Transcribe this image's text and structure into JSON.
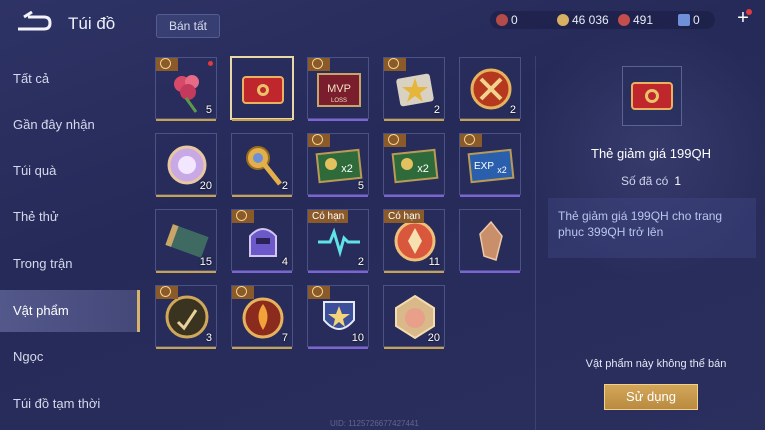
{
  "header": {
    "title": "Túi đồ",
    "sell_all_label": "Bán tất",
    "currencies": [
      {
        "icon": "red-gem-icon",
        "value": "0",
        "color": "#b44a4a"
      },
      {
        "icon": "gold-coin-icon",
        "value": "46 036",
        "color": "#d8b063"
      },
      {
        "icon": "red-crystal-icon",
        "value": "491",
        "color": "#c44d4d"
      },
      {
        "icon": "blue-voucher-icon",
        "value": "0",
        "color": "#6f8fd8"
      }
    ]
  },
  "sidebar": {
    "items": [
      {
        "label": "Tất cả"
      },
      {
        "label": "Gần đây nhận"
      },
      {
        "label": "Túi quà"
      },
      {
        "label": "Thẻ thử"
      },
      {
        "label": "Trong trận"
      },
      {
        "label": "Vật phẩm",
        "active": true
      },
      {
        "label": "Ngọc"
      },
      {
        "label": "Túi đồ tạm thời"
      }
    ]
  },
  "items": [
    {
      "icon": "rose-bouquet-icon",
      "count": "5",
      "tag": "coin",
      "red_dot": true,
      "under": "#c9a24a"
    },
    {
      "icon": "discount-card-icon",
      "count": "",
      "tag": "",
      "selected": true,
      "under": "#c9a24a"
    },
    {
      "icon": "mvp-loss-card-icon",
      "count": "",
      "tag": "coin",
      "under": "#7f62d8"
    },
    {
      "icon": "star-ticket-icon",
      "count": "2",
      "tag": "coin",
      "under": "#c9a24a"
    },
    {
      "icon": "crossed-swords-medal-icon",
      "count": "2",
      "tag": "",
      "under": "#c9a24a"
    },
    {
      "icon": "pink-orb-icon",
      "count": "20",
      "tag": "",
      "under": "#c9a24a"
    },
    {
      "icon": "golden-key-icon",
      "count": "2",
      "tag": "",
      "under": "#c9a24a"
    },
    {
      "icon": "coin-x2-card-icon",
      "count": "5",
      "tag": "coin",
      "under": "#7f62d8"
    },
    {
      "icon": "coin-x2-card-icon",
      "count": "",
      "tag": "coin",
      "under": "#7f62d8"
    },
    {
      "icon": "exp-x2-card-icon",
      "count": "",
      "tag": "coin",
      "under": "#7f62d8"
    },
    {
      "icon": "scroll-map-icon",
      "count": "15",
      "tag": "",
      "under": "#c9a24a"
    },
    {
      "icon": "knight-helmet-icon",
      "count": "4",
      "tag": "coin",
      "under": "#7f62d8"
    },
    {
      "icon": "heartbeat-card-icon",
      "count": "2",
      "tag": "Có hạn",
      "under": "#7f62d8"
    },
    {
      "icon": "red-medallion-icon",
      "count": "11",
      "tag": "Có hạn",
      "under": "#c9a24a"
    },
    {
      "icon": "crystal-shard-icon",
      "count": "",
      "tag": "",
      "under": "#7f62d8"
    },
    {
      "icon": "hand-check-coin-icon",
      "count": "3",
      "tag": "coin",
      "under": "#c9a24a"
    },
    {
      "icon": "flame-spirit-icon",
      "count": "7",
      "tag": "coin",
      "under": "#c9a24a"
    },
    {
      "icon": "rank-shield-icon",
      "count": "10",
      "tag": "coin",
      "under": "#7f62d8"
    },
    {
      "icon": "pig-portrait-icon",
      "count": "20",
      "tag": "",
      "under": "#c9a24a"
    }
  ],
  "detail": {
    "icon": "discount-card-icon",
    "name": "Thẻ giảm giá 199QH",
    "owned_label": "Số đã có",
    "owned_value": "1",
    "description": "Thẻ giảm giá 199QH cho trang phục 399QH trở lên",
    "not_sellable": "Vật phẩm này không thể bán",
    "use_label": "Sử dụng"
  },
  "uid": "UID: 1125726677427441"
}
